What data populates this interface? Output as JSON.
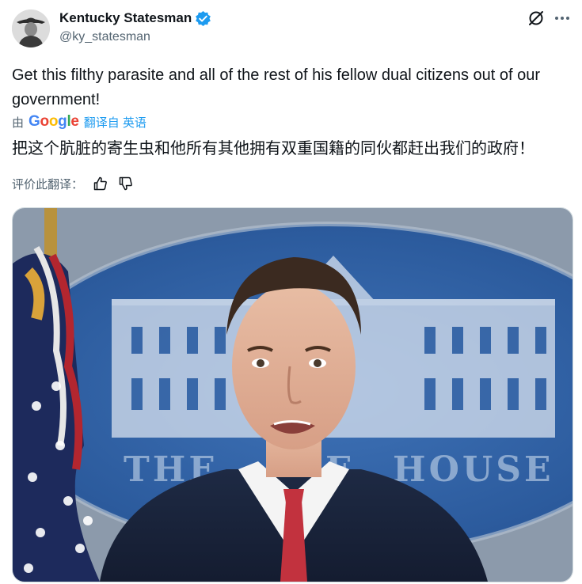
{
  "author": {
    "display_name": "Kentucky Statesman",
    "handle": "@ky_statesman",
    "verified_icon": "verified-badge-icon",
    "avatar_icon": "avatar"
  },
  "tweet": {
    "text": "Get this filthy parasite and all of the rest of his fellow dual citizens out of our government!"
  },
  "translation": {
    "by_label": "由",
    "google": [
      "G",
      "o",
      "o",
      "g",
      "l",
      "e"
    ],
    "link_label": "翻译自 英语",
    "translated_text": "把这个肮脏的寄生虫和他所有其他拥有双重国籍的同伙都赶出我们的政府！",
    "rate_label": "评价此翻译："
  },
  "media": {
    "sign_text": "THE WHITE HOUSE"
  },
  "icons": {
    "grok": "grok-icon",
    "more": "more-icon",
    "thumbs_up": "thumbs-up-icon",
    "thumbs_down": "thumbs-down-icon"
  },
  "colors": {
    "text": "#0f1419",
    "secondary": "#536471",
    "link": "#1d9bf0",
    "verified": "#1d9bf0"
  }
}
